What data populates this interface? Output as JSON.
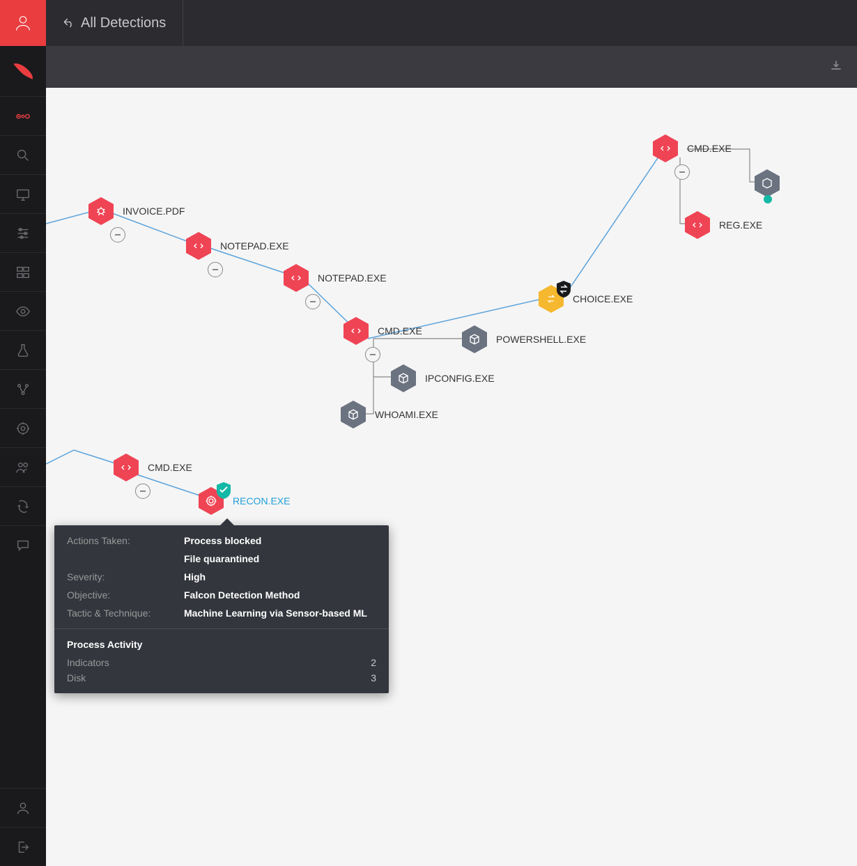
{
  "topbar": {
    "back_label": "All Detections"
  },
  "sidebar": {
    "items": [
      {
        "name": "activity-icon"
      },
      {
        "name": "search-icon"
      },
      {
        "name": "monitor-icon"
      },
      {
        "name": "sliders-icon"
      },
      {
        "name": "list-icon"
      },
      {
        "name": "eye-icon"
      },
      {
        "name": "flask-icon"
      },
      {
        "name": "branch-icon"
      },
      {
        "name": "target-icon"
      },
      {
        "name": "users-icon"
      },
      {
        "name": "swap-icon"
      },
      {
        "name": "message-icon"
      }
    ],
    "bottom": [
      {
        "name": "user-icon"
      },
      {
        "name": "logout-icon"
      }
    ]
  },
  "nodes": {
    "invoice": {
      "label": "INVOICE.PDF",
      "color": "#ef4454",
      "icon": "bug"
    },
    "notepad1": {
      "label": "NOTEPAD.EXE",
      "color": "#ef4454",
      "icon": "code"
    },
    "notepad2": {
      "label": "NOTEPAD.EXE",
      "color": "#ef4454",
      "icon": "code"
    },
    "cmd1": {
      "label": "CMD.EXE",
      "color": "#ef4454",
      "icon": "code"
    },
    "whoami": {
      "label": "WHOAMI.EXE",
      "color": "#6b7280",
      "icon": "cube"
    },
    "ipconfig": {
      "label": "IPCONFIG.EXE",
      "color": "#6b7280",
      "icon": "cube"
    },
    "powershell": {
      "label": "POWERSHELL.EXE",
      "color": "#6b7280",
      "icon": "cube"
    },
    "choice": {
      "label": "CHOICE.EXE",
      "color": "#f5b82e",
      "icon": "swap"
    },
    "cmd2": {
      "label": "CMD.EXE",
      "color": "#ef4454",
      "icon": "code"
    },
    "reg": {
      "label": "REG.EXE",
      "color": "#ef4454",
      "icon": "code"
    },
    "cmd3": {
      "label": "CMD.EXE",
      "color": "#ef4454",
      "icon": "code"
    },
    "recon": {
      "label": "RECON.EXE",
      "color": "#ef4454",
      "icon": "target",
      "selected": true
    }
  },
  "tooltip": {
    "rows": [
      {
        "key": "Actions Taken:",
        "vals": [
          "Process blocked",
          "File quarantined"
        ]
      },
      {
        "key": "Severity:",
        "vals": [
          "High"
        ]
      },
      {
        "key": "Objective:",
        "vals": [
          "Falcon Detection Method"
        ]
      },
      {
        "key": "Tactic & Technique:",
        "vals": [
          "Machine Learning via Sensor-based ML"
        ]
      }
    ],
    "activity_header": "Process Activity",
    "activity": [
      {
        "k": "Indicators",
        "v": "2"
      },
      {
        "k": "Disk",
        "v": "3"
      }
    ]
  }
}
